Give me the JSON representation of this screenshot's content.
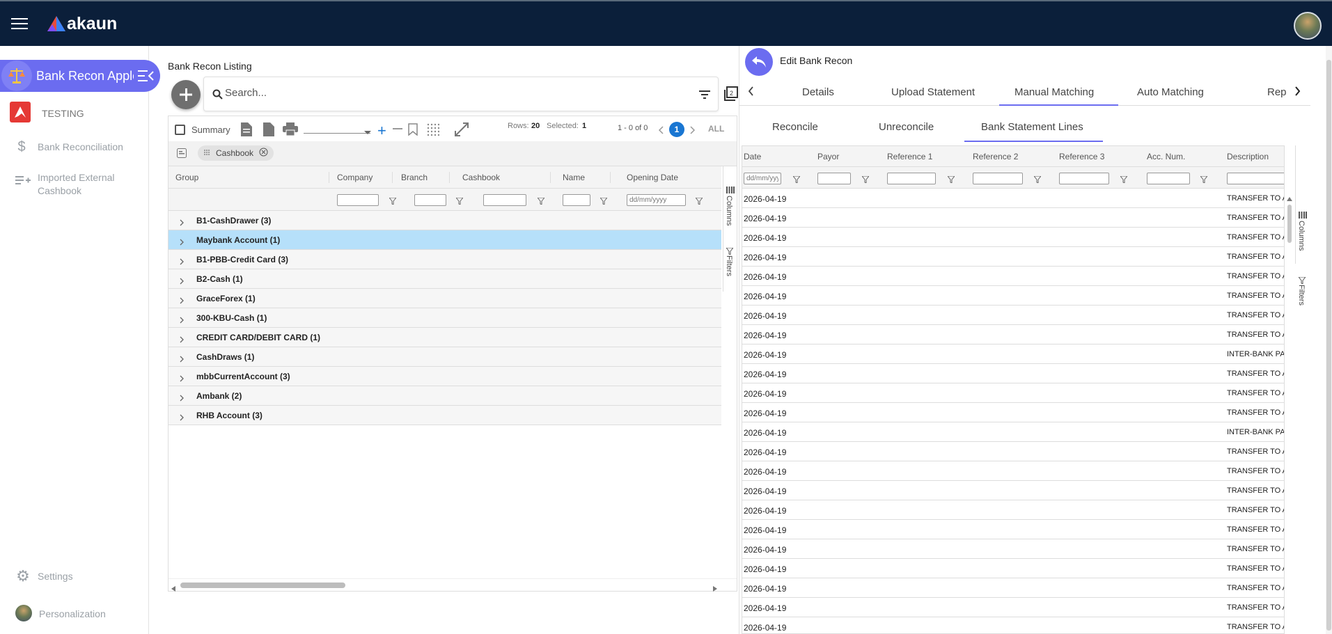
{
  "header": {
    "brand": "akaun"
  },
  "sidebar": {
    "app_name": "Bank Recon Apple",
    "items": [
      {
        "label": "TESTING",
        "icon": "testing-logo-icon"
      },
      {
        "label": "Bank Reconciliation",
        "icon": "dollar-icon"
      },
      {
        "label": "Imported External Cashbook",
        "icon": "playlist-add-icon"
      }
    ],
    "settings_label": "Settings",
    "personalization_label": "Personalization"
  },
  "left": {
    "title": "Bank Recon Listing",
    "search_placeholder": "Search...",
    "toolbar": {
      "summary_label": "Summary",
      "rows_label": "Rows:",
      "rows_value": "20",
      "selected_label": "Selected:",
      "selected_value": "1",
      "range": "1 - 0 of 0",
      "page": "1",
      "all_label": "ALL"
    },
    "group_chip": "Cashbook",
    "columns": [
      "Group",
      "Company",
      "Branch",
      "Cashbook",
      "Name",
      "Opening Date"
    ],
    "date_placeholder": "dd/mm/yyyy",
    "groups": [
      "B1-CashDrawer (3)",
      "Maybank Account (1)",
      "B1-PBB-Credit Card (3)",
      "B2-Cash (1)",
      "GraceForex (1)",
      "300-KBU-Cash (1)",
      "CREDIT CARD/DEBIT CARD (1)",
      "CashDraws (1)",
      "mbbCurrentAccount (3)",
      "Ambank (2)",
      "RHB Account (3)"
    ],
    "side_tabs": [
      "Columns",
      "Filters"
    ]
  },
  "right": {
    "title": "Edit Bank Recon",
    "tabs": [
      "Details",
      "Upload Statement",
      "Manual Matching",
      "Auto Matching",
      "Rep"
    ],
    "subtabs": [
      "Reconcile",
      "Unreconcile",
      "Bank Statement Lines"
    ],
    "columns": [
      "Date",
      "Payor",
      "Reference 1",
      "Reference 2",
      "Reference 3",
      "Acc. Num.",
      "Description"
    ],
    "date_placeholder": "dd/mm/yyyy",
    "rows": [
      {
        "date": "2026-04-19",
        "desc": "TRANSFER TO A"
      },
      {
        "date": "2026-04-19",
        "desc": "TRANSFER TO A"
      },
      {
        "date": "2026-04-19",
        "desc": "TRANSFER TO A"
      },
      {
        "date": "2026-04-19",
        "desc": "TRANSFER TO A"
      },
      {
        "date": "2026-04-19",
        "desc": "TRANSFER TO A"
      },
      {
        "date": "2026-04-19",
        "desc": "TRANSFER TO A"
      },
      {
        "date": "2026-04-19",
        "desc": "TRANSFER TO A"
      },
      {
        "date": "2026-04-19",
        "desc": "TRANSFER TO A"
      },
      {
        "date": "2026-04-19",
        "desc": "INTER-BANK PA"
      },
      {
        "date": "2026-04-19",
        "desc": "TRANSFER TO A"
      },
      {
        "date": "2026-04-19",
        "desc": "TRANSFER TO A"
      },
      {
        "date": "2026-04-19",
        "desc": "TRANSFER TO A"
      },
      {
        "date": "2026-04-19",
        "desc": "INTER-BANK PA"
      },
      {
        "date": "2026-04-19",
        "desc": "TRANSFER TO A"
      },
      {
        "date": "2026-04-19",
        "desc": "TRANSFER TO A"
      },
      {
        "date": "2026-04-19",
        "desc": "TRANSFER TO A"
      },
      {
        "date": "2026-04-19",
        "desc": "TRANSFER TO A"
      },
      {
        "date": "2026-04-19",
        "desc": "TRANSFER TO A"
      },
      {
        "date": "2026-04-19",
        "desc": "TRANSFER TO A"
      },
      {
        "date": "2026-04-19",
        "desc": "TRANSFER TO A"
      },
      {
        "date": "2026-04-19",
        "desc": "TRANSFER TO A"
      },
      {
        "date": "2026-04-19",
        "desc": "TRANSFER TO A"
      },
      {
        "date": "2026-04-19",
        "desc": "TRANSFER TO A"
      }
    ],
    "side_tabs": [
      "Columns",
      "Filters"
    ]
  },
  "colors": {
    "topbar": "#0b1f3a",
    "accent": "#6b6cf0",
    "selected_row": "#b6e0fa",
    "page_blue": "#1976d2"
  }
}
